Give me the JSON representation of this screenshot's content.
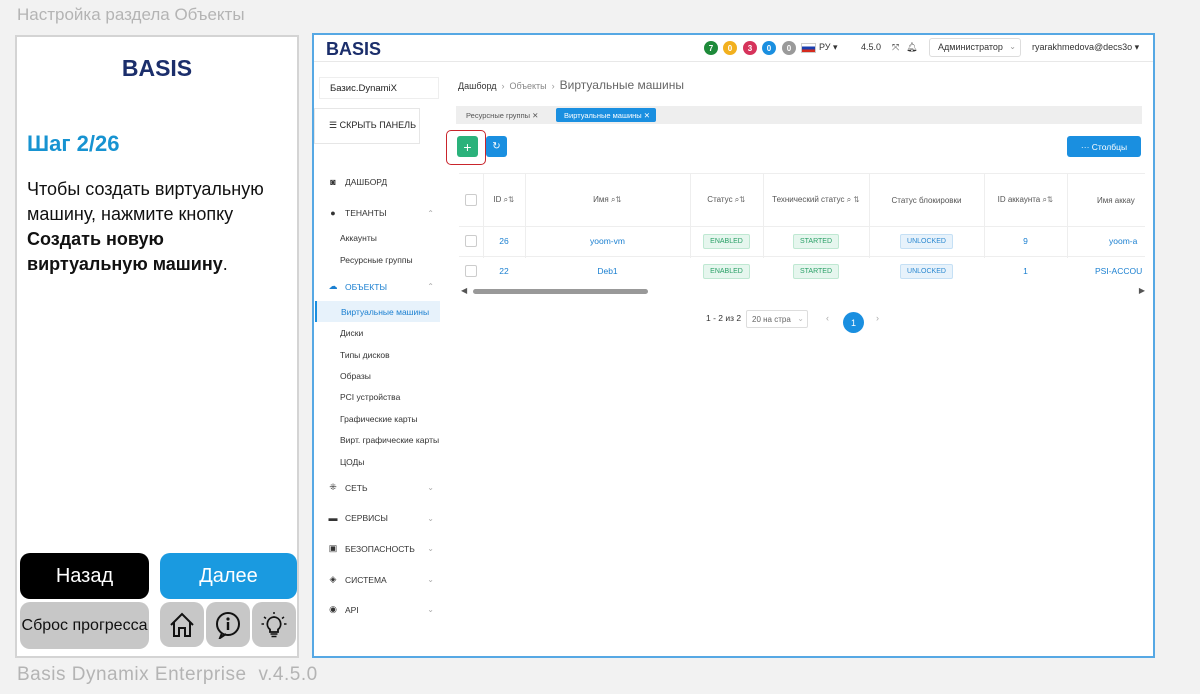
{
  "page_title": "Настройка раздела Объекты",
  "footer": {
    "product": "Basis Dynamix Enterprise",
    "version": "v.4.5.0"
  },
  "guide": {
    "logo": "BASIS",
    "step": "Шаг 2/26",
    "instruction_plain": "Чтобы создать виртуальную машину, нажмите кнопку ",
    "instruction_bold": "Создать новую виртуальную машину",
    "instruction_end": ".",
    "back": "Назад",
    "next": "Далее",
    "reset": "Сброс прогресса"
  },
  "app": {
    "logo": "BASIS",
    "status_counts": [
      {
        "value": "7",
        "color": "#1e8a3a"
      },
      {
        "value": "0",
        "color": "#f2b01e"
      },
      {
        "value": "3",
        "color": "#d6335b"
      },
      {
        "value": "0",
        "color": "#1a8fe0"
      },
      {
        "value": "0",
        "color": "#9a9a9a"
      }
    ],
    "lang": "РУ ▾",
    "version": "4.5.0",
    "role": "Администратор",
    "user": "ryarakhmedova@decs3o ▾",
    "sidebar": {
      "tenant": "Базис.DynamiX",
      "hide_panel": "СКРЫТЬ ПАНЕЛЬ",
      "dashboard": "ДАШБОРД",
      "tenants": "ТЕНАНТЫ",
      "tenants_sub": [
        "Аккаунты",
        "Ресурсные группы"
      ],
      "objects": "ОБЪЕКТЫ",
      "objects_sub": [
        "Виртуальные машины",
        "Диски",
        "Типы дисков",
        "Образы",
        "PCI устройства",
        "Графические карты",
        "Вирт. графические карты",
        "ЦОДы"
      ],
      "network": "СЕТЬ",
      "services": "СЕРВИСЫ",
      "security": "БЕЗОПАСНОСТЬ",
      "system": "СИСТЕМА",
      "api": "API"
    },
    "breadcrumb": {
      "home": "Дашборд",
      "section": "Объекты",
      "current": "Виртуальные машины"
    },
    "tabs": {
      "resource_groups": "Ресурсные группы ✕",
      "virtual_machines": "Виртуальные машины ✕"
    },
    "columns_button": "··· Столбцы",
    "table": {
      "headers": {
        "id": "ID ⌕⇅",
        "name": "Имя ⌕⇅",
        "status": "Статус ⌕⇅",
        "tech_status": "Технический статус ⌕ ⇅",
        "lock_status": "Статус блокировки",
        "account_id": "ID аккаунта ⌕⇅",
        "account_name": "Имя аккау"
      },
      "rows": [
        {
          "id": "26",
          "name": "yoom-vm",
          "status": "ENABLED",
          "tech_status": "STARTED",
          "lock": "UNLOCKED",
          "account_id": "9",
          "account_name": "yoom-a"
        },
        {
          "id": "22",
          "name": "Deb1",
          "status": "ENABLED",
          "tech_status": "STARTED",
          "lock": "UNLOCKED",
          "account_id": "1",
          "account_name": "PSI-ACCOU"
        }
      ]
    },
    "pager": {
      "range": "1 - 2 из 2",
      "size": "20 на стра",
      "page": "1"
    }
  }
}
